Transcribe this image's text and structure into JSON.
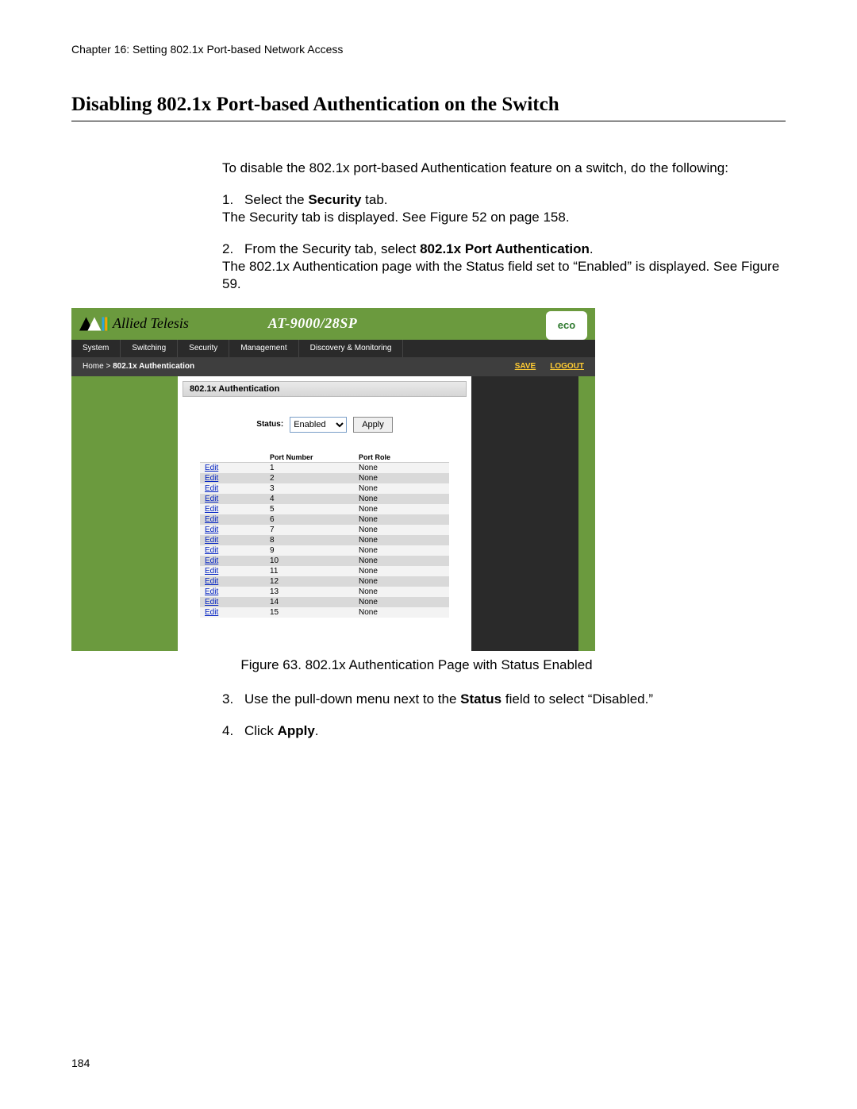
{
  "page_header": "Chapter 16: Setting 802.1x Port-based Network Access",
  "section_title": "Disabling 802.1x Port-based Authentication on the Switch",
  "intro_para": "To disable the 802.1x port-based Authentication feature on a switch, do the following:",
  "steps": {
    "s1_num": "1.",
    "s1_pre": "Select the ",
    "s1_bold": "Security",
    "s1_post": " tab.",
    "s1_result": "The Security tab is displayed. See Figure 52 on page 158.",
    "s2_num": "2.",
    "s2_pre": "From the Security tab, select ",
    "s2_bold": "802.1x Port Authentication",
    "s2_post": ".",
    "s2_result": "The 802.1x Authentication page with the Status field set to “Enabled” is displayed. See Figure 59.",
    "s3_num": "3.",
    "s3_pre": "Use the pull-down menu next to the ",
    "s3_bold": "Status",
    "s3_post": " field to select “Disabled.”",
    "s4_num": "4.",
    "s4_pre": "Click ",
    "s4_bold": "Apply",
    "s4_post": "."
  },
  "figure_caption": "Figure 63. 802.1x Authentication Page with Status Enabled",
  "page_number": "184",
  "screenshot": {
    "brand": "Allied Telesis",
    "model": "AT-9000/28SP",
    "eco_label": "eco",
    "tabs": [
      "System",
      "Switching",
      "Security",
      "Management",
      "Discovery & Monitoring"
    ],
    "breadcrumb_home": "Home",
    "breadcrumb_sep": " > ",
    "breadcrumb_page": "802.1x Authentication",
    "save": "SAVE",
    "logout": "LOGOUT",
    "panel_title": "802.1x Authentication",
    "status_label": "Status:",
    "status_value": "Enabled",
    "apply_label": "Apply",
    "columns": {
      "edit": "",
      "port": "Port Number",
      "role": "Port Role"
    },
    "edit_label": "Edit",
    "rows": [
      {
        "port": "1",
        "role": "None"
      },
      {
        "port": "2",
        "role": "None"
      },
      {
        "port": "3",
        "role": "None"
      },
      {
        "port": "4",
        "role": "None"
      },
      {
        "port": "5",
        "role": "None"
      },
      {
        "port": "6",
        "role": "None"
      },
      {
        "port": "7",
        "role": "None"
      },
      {
        "port": "8",
        "role": "None"
      },
      {
        "port": "9",
        "role": "None"
      },
      {
        "port": "10",
        "role": "None"
      },
      {
        "port": "11",
        "role": "None"
      },
      {
        "port": "12",
        "role": "None"
      },
      {
        "port": "13",
        "role": "None"
      },
      {
        "port": "14",
        "role": "None"
      },
      {
        "port": "15",
        "role": "None"
      }
    ]
  }
}
